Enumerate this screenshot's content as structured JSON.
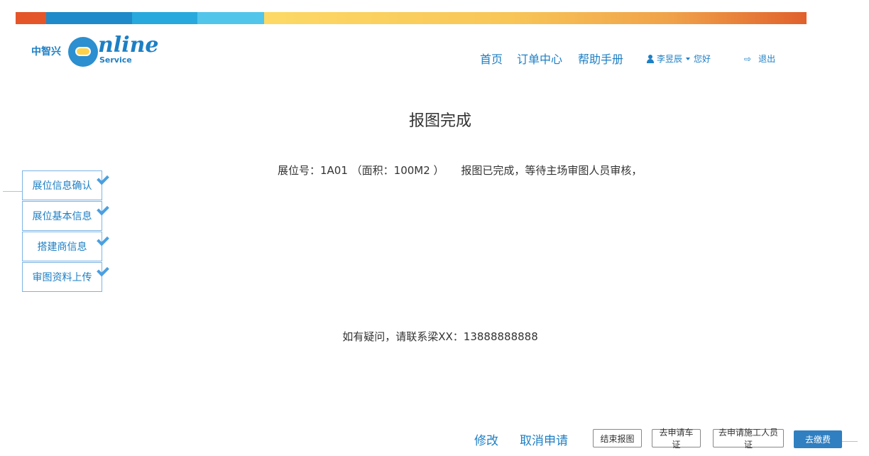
{
  "brand": {
    "cn_name": "中智兴",
    "word": "nline",
    "sub": "Service"
  },
  "nav": {
    "home": "首页",
    "orders": "订单中心",
    "help": "帮助手册"
  },
  "user": {
    "name": "李昱辰",
    "greeting": "您好"
  },
  "logout": {
    "label": "退出"
  },
  "page": {
    "title": "报图完成",
    "info": "展位号：1A01 （面积：100M2 ）     报图已完成，等待主场审图人员审核，",
    "contact": "如有疑问，请联系梁XX：13888888888"
  },
  "steps": [
    {
      "label": "展位信息确认",
      "done": true
    },
    {
      "label": "展位基本信息",
      "done": true
    },
    {
      "label": "搭建商信息",
      "done": true
    },
    {
      "label": "审图资料上传",
      "done": true
    }
  ],
  "actions": {
    "modify": "修改",
    "cancel": "取消申请",
    "end_report": "结束报图",
    "apply_vehicle": "去申请车证",
    "apply_worker": "去申请施工人员证",
    "pay": "去缴费"
  },
  "colors": {
    "accent": "#1d7fc4",
    "primary_button": "#2f7fc1"
  }
}
